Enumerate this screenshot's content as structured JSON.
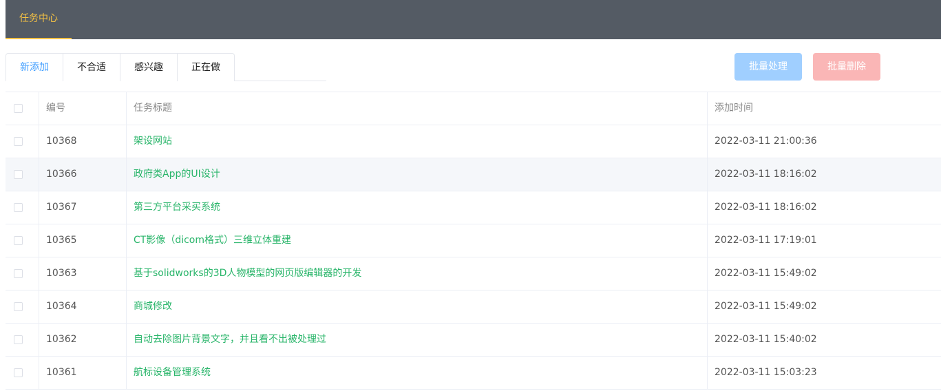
{
  "topbar": {
    "tab_label": "任务中心"
  },
  "tabs": [
    {
      "label": "新添加",
      "active": true
    },
    {
      "label": "不合适",
      "active": false
    },
    {
      "label": "感兴趣",
      "active": false
    },
    {
      "label": "正在做",
      "active": false
    }
  ],
  "actions": {
    "batch_process": "批量处理",
    "batch_delete": "批量删除"
  },
  "colors": {
    "topbar_bg": "#545b64",
    "accent_yellow": "#f5c244",
    "active_tab": "#409eff",
    "title_link": "#29b56a",
    "batch_process_bg": "#a0cfff",
    "batch_delete_bg": "#fab6b6"
  },
  "table": {
    "headers": {
      "id": "编号",
      "title": "任务标题",
      "time": "添加时间"
    },
    "rows": [
      {
        "id": "10368",
        "title": "架设网站",
        "time": "2022-03-11 21:00:36"
      },
      {
        "id": "10366",
        "title": "政府类App的UI设计",
        "time": "2022-03-11 18:16:02"
      },
      {
        "id": "10367",
        "title": "第三方平台采买系统",
        "time": "2022-03-11 18:16:02"
      },
      {
        "id": "10365",
        "title": "CT影像（dicom格式）三维立体重建",
        "time": "2022-03-11 17:19:01"
      },
      {
        "id": "10363",
        "title": "基于solidworks的3D人物模型的网页版编辑器的开发",
        "time": "2022-03-11 15:49:02"
      },
      {
        "id": "10364",
        "title": "商城修改",
        "time": "2022-03-11 15:49:02"
      },
      {
        "id": "10362",
        "title": "自动去除图片背景文字，并且看不出被处理过",
        "time": "2022-03-11 15:40:02"
      },
      {
        "id": "10361",
        "title": "航标设备管理系统",
        "time": "2022-03-11 15:03:23"
      }
    ]
  }
}
